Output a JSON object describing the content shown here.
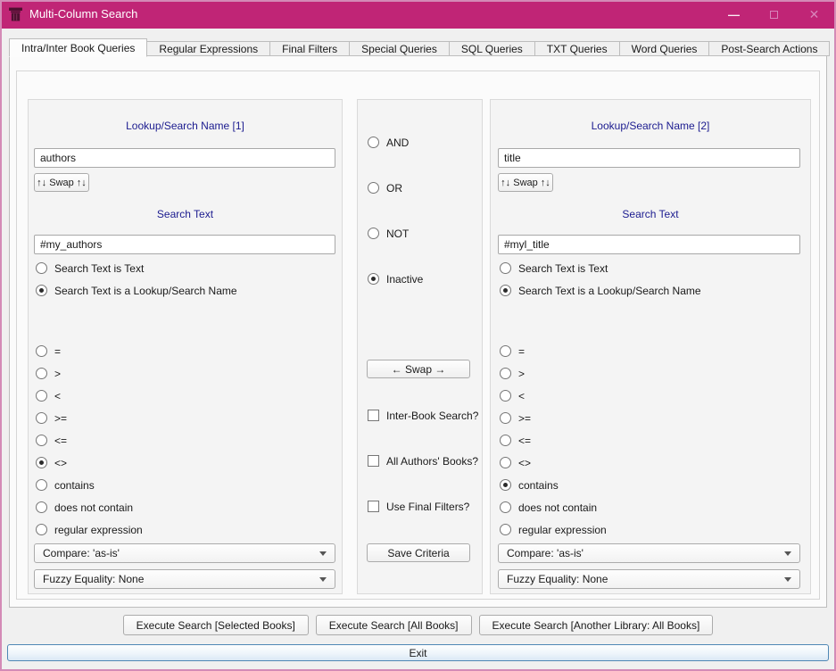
{
  "window": {
    "title": "Multi-Column Search"
  },
  "titlebar_controls": {
    "minimize": "—",
    "close": "✕"
  },
  "colors": {
    "titlebar": "#c02576",
    "window_border": "#d48ab6",
    "section_label": "#1b1b8f",
    "exit_border": "#4f87b5"
  },
  "tabs": [
    {
      "label": "Intra/Inter Book Queries",
      "active": true
    },
    {
      "label": "Regular Expressions",
      "active": false
    },
    {
      "label": "Final Filters",
      "active": false
    },
    {
      "label": "Special Queries",
      "active": false
    },
    {
      "label": "SQL Queries",
      "active": false
    },
    {
      "label": "TXT Queries",
      "active": false
    },
    {
      "label": "Word Queries",
      "active": false
    },
    {
      "label": "Post-Search Actions",
      "active": false
    }
  ],
  "columns": {
    "left": {
      "header": "Lookup/Search Name [1]",
      "name_value": "authors",
      "swap_button": "↑↓ Swap ↑↓",
      "search_text_header": "Search Text",
      "search_text_value": "#my_authors",
      "text_type_radios": [
        {
          "label": "Search Text is Text",
          "checked": false
        },
        {
          "label": "Search Text is a Lookup/Search Name",
          "checked": true
        }
      ],
      "operator_radios": [
        {
          "label": "=",
          "checked": false
        },
        {
          "label": ">",
          "checked": false
        },
        {
          "label": "<",
          "checked": false
        },
        {
          "label": ">=",
          "checked": false
        },
        {
          "label": "<=",
          "checked": false
        },
        {
          "label": "<>",
          "checked": true
        },
        {
          "label": "contains",
          "checked": false
        },
        {
          "label": "does not contain",
          "checked": false
        },
        {
          "label": "regular expression",
          "checked": false
        }
      ],
      "compare_select": "Compare: 'as-is'",
      "fuzzy_select": "Fuzzy Equality: None"
    },
    "middle": {
      "logic_radios": [
        {
          "label": "AND",
          "checked": false
        },
        {
          "label": "OR",
          "checked": false
        },
        {
          "label": "NOT",
          "checked": false
        },
        {
          "label": "Inactive",
          "checked": true
        }
      ],
      "swap_button": "← Swap →",
      "checkboxes": [
        {
          "label": "Inter-Book Search?",
          "checked": false
        },
        {
          "label": "All Authors' Books?",
          "checked": false
        },
        {
          "label": "Use Final Filters?",
          "checked": false
        }
      ],
      "save_button": "Save Criteria"
    },
    "right": {
      "header": "Lookup/Search Name [2]",
      "name_value": "title",
      "swap_button": "↑↓ Swap ↑↓",
      "search_text_header": "Search Text",
      "search_text_value": "#myl_title",
      "text_type_radios": [
        {
          "label": "Search Text is Text",
          "checked": false
        },
        {
          "label": "Search Text is a Lookup/Search Name",
          "checked": true
        }
      ],
      "operator_radios": [
        {
          "label": "=",
          "checked": false
        },
        {
          "label": ">",
          "checked": false
        },
        {
          "label": "<",
          "checked": false
        },
        {
          "label": ">=",
          "checked": false
        },
        {
          "label": "<=",
          "checked": false
        },
        {
          "label": "<>",
          "checked": false
        },
        {
          "label": "contains",
          "checked": true
        },
        {
          "label": "does not contain",
          "checked": false
        },
        {
          "label": "regular expression",
          "checked": false
        }
      ],
      "compare_select": "Compare: 'as-is'",
      "fuzzy_select": "Fuzzy Equality: None"
    }
  },
  "footer": {
    "execute_buttons": [
      "Execute Search [Selected Books]",
      "Execute Search [All Books]",
      "Execute Search [Another Library: All Books]"
    ],
    "exit": "Exit"
  }
}
